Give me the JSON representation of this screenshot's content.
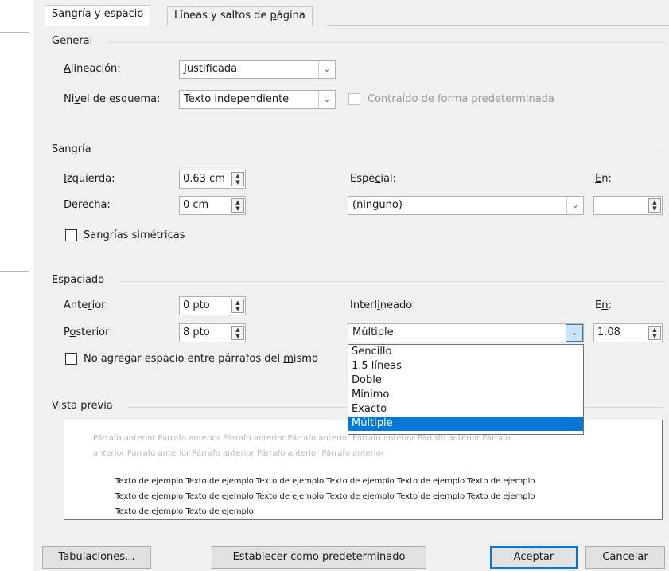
{
  "tabs": [
    {
      "label": "Sangría y espacio",
      "underline": "S",
      "rest": "angría y espacio"
    },
    {
      "label": "Líneas y saltos de página",
      "pre": "Líneas y saltos de ",
      "underline": "p",
      "rest": "ágina"
    }
  ],
  "general": {
    "title": "General",
    "alignment": {
      "label_u": "A",
      "label_rest": "lineación:",
      "value": "Justificada"
    },
    "outline": {
      "label_pre": "Ni",
      "label_u": "v",
      "label_rest": "el de esquema:",
      "value": "Texto independiente"
    },
    "collapsed": {
      "label": "Contraído de forma predeterminada"
    }
  },
  "indent": {
    "title": "Sangría",
    "left": {
      "label_u": "I",
      "label_rest": "zquierda:",
      "value": "0.63 cm"
    },
    "right": {
      "label_u": "D",
      "label_rest": "erecha:",
      "value": "0 cm"
    },
    "special": {
      "label_pre": "Espe",
      "label_u": "c",
      "label_rest": "ial:",
      "value": "(ninguno)"
    },
    "by": {
      "label_u": "E",
      "label_rest": "n:",
      "value": ""
    },
    "mirror": {
      "label_pre": "San",
      "label_u": "g",
      "label_rest": "rías simétricas"
    }
  },
  "spacing": {
    "title": "Espaciado",
    "before": {
      "label_pre": "Ante",
      "label_u": "r",
      "label_rest": "ior:",
      "value": "0 pto"
    },
    "after": {
      "label_pre": "P",
      "label_u": "o",
      "label_rest": "sterior:",
      "value": "8 pto"
    },
    "line": {
      "label_pre": "Interl",
      "label_u": "i",
      "label_rest": "neado:",
      "value": "Múltiple"
    },
    "at": {
      "label_pre": "E",
      "label_u": "n",
      "label_rest": ":",
      "value": "1.08"
    },
    "no_space": {
      "label_pre": "No agregar espacio entre párrafos del ",
      "label_u": "m",
      "label_rest": "ismo"
    }
  },
  "line_options": [
    "Sencillo",
    "1.5 líneas",
    "Doble",
    "Mínimo",
    "Exacto",
    "Múltiple"
  ],
  "line_selected": "Múltiple",
  "preview": {
    "title": "Vista previa",
    "prev_line1": "Párrafo anterior Párrafo anterior Párrafo anterior Párrafo anterior Párrafo anterior Párrafo anterior Párrafo",
    "prev_line2": "anterior Párrafo anterior Párrafo anterior Párrafo anterior Párrafo anterior",
    "sample_line1": "Texto de ejemplo Texto de ejemplo Texto de ejemplo Texto de ejemplo Texto de ejemplo Texto de ejemplo",
    "sample_line2": "Texto de ejemplo Texto de ejemplo Texto de ejemplo Texto de ejemplo Texto de ejemplo Texto de ejemplo",
    "sample_line3": "Texto de ejemplo Texto de ejemplo"
  },
  "buttons": {
    "tabs": {
      "label_u": "T",
      "label_rest": "abulaciones..."
    },
    "default": {
      "label_pre": "Establecer como pre",
      "label_u": "d",
      "label_rest": "eterminado"
    },
    "ok": "Aceptar",
    "cancel": "Cancelar"
  },
  "colors": {
    "accent": "#0078d7",
    "selection": "#0078d7"
  }
}
